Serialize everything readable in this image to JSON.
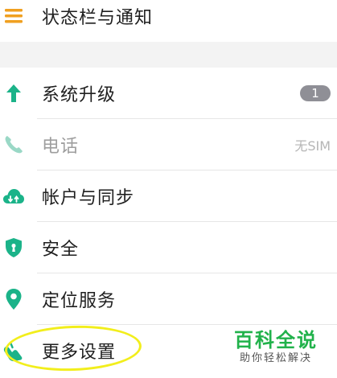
{
  "colors": {
    "accent_green": "#1bb389",
    "menu_orange": "#f0a020",
    "watermark_green": "#21b24b",
    "highlight_yellow": "#f2ee1c",
    "badge_gray": "#8f8f96"
  },
  "settings": {
    "top_item": {
      "label": "状态栏与通知",
      "icon": "menu-lines-icon"
    },
    "items": [
      {
        "label": "系统升级",
        "icon": "arrow-up-icon",
        "badge": "1"
      },
      {
        "label": "电话",
        "icon": "phone-icon",
        "value": "无SIM",
        "disabled": true
      },
      {
        "label": "帐户与同步",
        "icon": "cloud-sync-icon"
      },
      {
        "label": "安全",
        "icon": "shield-icon"
      },
      {
        "label": "定位服务",
        "icon": "location-pin-icon"
      },
      {
        "label": "更多设置",
        "icon": "settings-hand-icon"
      }
    ]
  },
  "watermark": {
    "title": "百科全说",
    "subtitle": "助你轻松解决"
  }
}
